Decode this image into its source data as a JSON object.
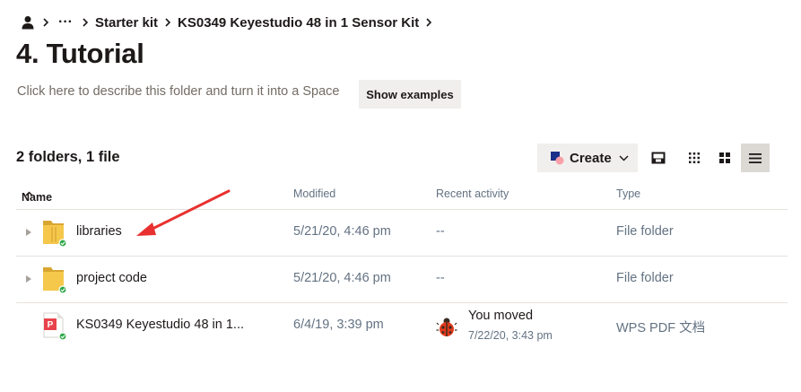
{
  "breadcrumb": {
    "more": "···",
    "items": [
      "Starter kit",
      "KS0349 Keyestudio 48 in 1 Sensor Kit"
    ]
  },
  "page": {
    "title": "4. Tutorial",
    "description": "Click here to describe this folder and turn it into a Space",
    "show_examples": "Show examples"
  },
  "toolbar": {
    "summary": "2 folders, 1 file",
    "create_label": "Create",
    "accent": "#0061fe",
    "active_view": "list"
  },
  "table": {
    "headers": {
      "name": "Name",
      "modified": "Modified",
      "activity": "Recent activity",
      "type": "Type"
    },
    "rows": [
      {
        "name": "libraries",
        "modified": "5/21/20, 4:46 pm",
        "activity": "--",
        "type": "File folder",
        "icon": "folder-icon"
      },
      {
        "name": "project code",
        "modified": "5/21/20, 4:46 pm",
        "activity": "--",
        "type": "File folder",
        "icon": "folder-icon"
      },
      {
        "name": "KS0349 Keyestudio 48 in 1...",
        "modified": "6/4/19, 3:39 pm",
        "activity_line1": "You moved",
        "activity_line2": "7/22/20, 3:43 pm",
        "type": "WPS PDF 文档",
        "icon": "pdf-file-icon"
      }
    ]
  },
  "colors": {
    "annotation_arrow": "#e8312f",
    "folder": "#f5c84c",
    "sync_badge": "#29a744"
  }
}
